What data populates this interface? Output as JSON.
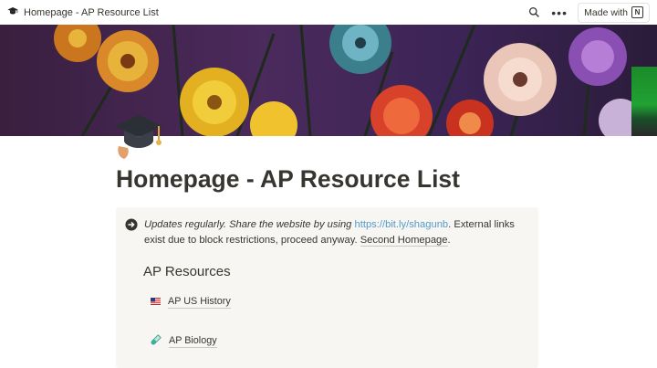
{
  "topbar": {
    "page_icon": "graduation-cap-icon",
    "breadcrumb_title": "Homepage - AP Resource List",
    "made_with_label": "Made with",
    "more_label": "•••"
  },
  "page": {
    "title": "Homepage - AP Resource List",
    "icon": "graduation-cap-icon"
  },
  "callout": {
    "icon": "arrow-circle-right-icon",
    "text_italic": "Updates regularly. Share the website by using",
    "link_url_text": "https://bit.ly/shagunb",
    "text_after_link": ". External links exist due to block restrictions, proceed anyway.",
    "second_homepage_label": "Second Homepage",
    "text_end": "."
  },
  "resources": {
    "heading": "AP Resources",
    "items": [
      {
        "icon": "us-flag-icon",
        "label": "AP US History"
      },
      {
        "icon": "test-tube-icon",
        "label": "AP Biology"
      }
    ]
  },
  "colors": {
    "text": "#37352f",
    "link_blue": "#529cca",
    "callout_bg": "#f7f6f3"
  }
}
